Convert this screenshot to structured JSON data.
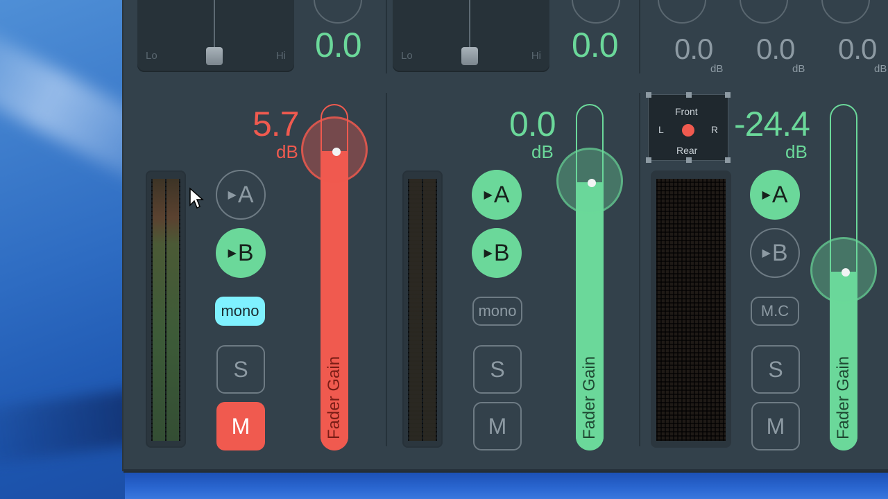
{
  "channels": [
    {
      "eq": {
        "lo": "Lo",
        "hi": "Hi"
      },
      "top_value": "0.0",
      "gain": {
        "value": "5.7",
        "unit": "dB"
      },
      "buttons": {
        "a": "A",
        "b": "B",
        "mode": "mono",
        "solo": "S",
        "mute": "M"
      },
      "fader": {
        "label": "Fader Gain",
        "level": 0.87
      }
    },
    {
      "eq": {
        "lo": "Lo",
        "hi": "Hi"
      },
      "top_value": "0.0",
      "gain": {
        "value": "0.0",
        "unit": "dB"
      },
      "buttons": {
        "a": "A",
        "b": "B",
        "mode": "mono",
        "solo": "S",
        "mute": "M"
      },
      "fader": {
        "label": "Fader Gain",
        "level": 0.78
      }
    },
    {
      "top_values": [
        {
          "value": "0.0",
          "unit": "dB"
        },
        {
          "value": "0.0",
          "unit": "dB"
        },
        {
          "value": "0.0",
          "unit": "dB"
        }
      ],
      "panner": {
        "front": "Front",
        "rear": "Rear",
        "left": "L",
        "right": "R"
      },
      "gain": {
        "value": "-24.4",
        "unit": "dB"
      },
      "buttons": {
        "a": "A",
        "b": "B",
        "mode": "M.C",
        "solo": "S",
        "mute": "M"
      },
      "fader": {
        "label": "Fader Gain",
        "level": 0.52
      }
    }
  ],
  "colors": {
    "accent_green": "#6bd89a",
    "accent_red": "#f05a4f",
    "mono_on": "#7ff1ff",
    "panel_bg": "#33414b"
  }
}
